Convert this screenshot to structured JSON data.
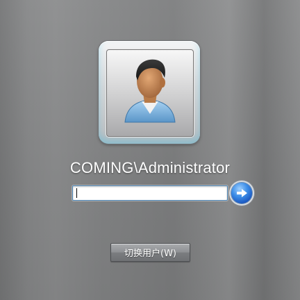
{
  "user": {
    "display_name": "COMING\\Administrator",
    "avatar_icon": "user-avatar-icon"
  },
  "login": {
    "password_value": "",
    "submit_icon": "arrow-right-icon"
  },
  "switch_user": {
    "label": "切换用户(W)"
  },
  "colors": {
    "background": "#858687",
    "tile_glow": "#37bee6",
    "submit_button": "#1b59c2"
  }
}
